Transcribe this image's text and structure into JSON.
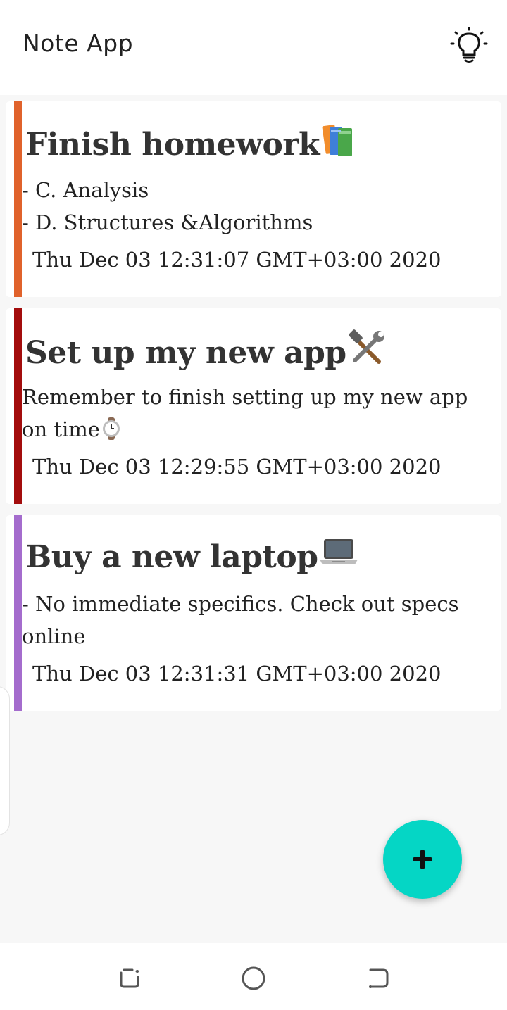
{
  "app_bar": {
    "title": "Note App",
    "theme_icon": "lightbulb-icon"
  },
  "notes": [
    {
      "title": "Finish homework",
      "title_emoji": "books",
      "body": "- C. Analysis\n- D. Structures &Algorithms",
      "date": "Thu Dec 03 12:31:07 GMT+03:00 2020",
      "accent_color": "#e0622b"
    },
    {
      "title": "Set up my new app",
      "title_emoji": "hammer-and-wrench",
      "body": "Remember to finish setting up my new app on time",
      "body_emoji": "watch",
      "date": "Thu Dec 03 12:29:55 GMT+03:00 2020",
      "accent_color": "#a30d0d"
    },
    {
      "title": "Buy a new laptop",
      "title_emoji": "laptop",
      "body": "- No immediate specifics. Check out specs online",
      "date": "Thu Dec 03 12:31:31 GMT+03:00 2020",
      "accent_color": "#a46ccd"
    }
  ],
  "fab": {
    "icon": "plus-icon",
    "color": "#05d6c5"
  },
  "nav_bar": {
    "icons": [
      "recent-apps-icon",
      "home-icon",
      "back-icon"
    ]
  }
}
